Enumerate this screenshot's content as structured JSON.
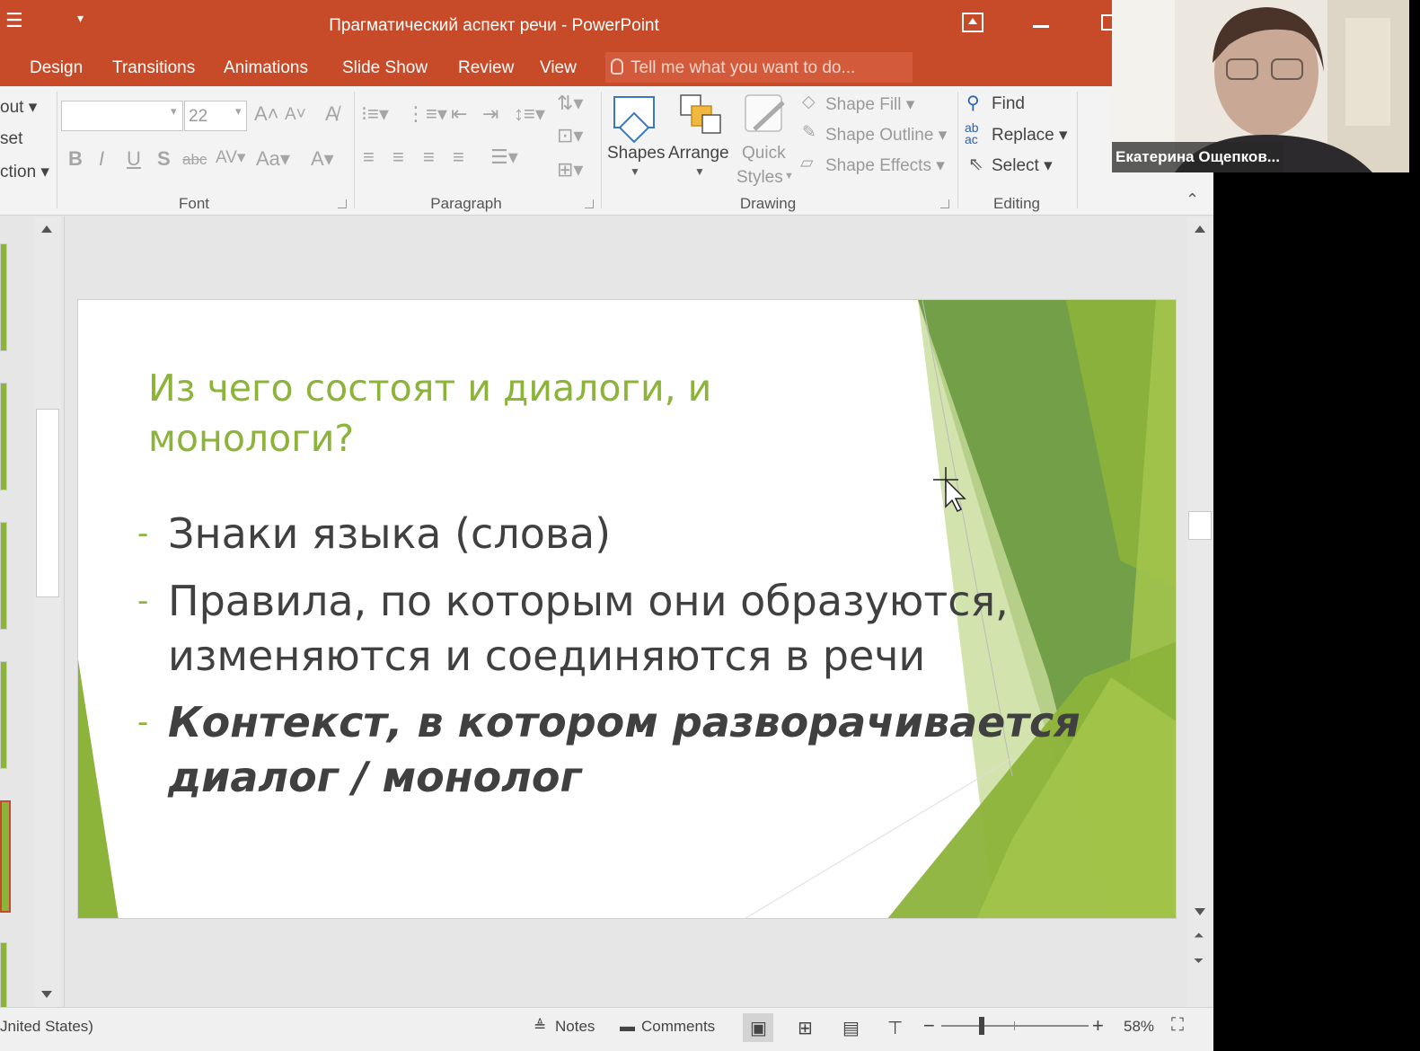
{
  "window": {
    "title": "Прагматический аспект речи - PowerPoint"
  },
  "tabs": [
    "Design",
    "Transitions",
    "Animations",
    "Slide Show",
    "Review",
    "View"
  ],
  "tellme": "Tell me what you want to do...",
  "ribbon": {
    "layout_partial": [
      "out",
      "set",
      "ction"
    ],
    "font_size": "22",
    "font_group": "Font",
    "paragraph_group": "Paragraph",
    "drawing_group": "Drawing",
    "editing_group": "Editing",
    "shapes": "Shapes",
    "arrange": "Arrange",
    "quick_styles_1": "Quick",
    "quick_styles_2": "Styles",
    "shape_fill": "Shape Fill",
    "shape_outline": "Shape Outline",
    "shape_effects": "Shape Effects",
    "find": "Find",
    "replace": "Replace",
    "select": "Select"
  },
  "slide": {
    "title_line1": "Из чего состоят и диалоги, и",
    "title_line2": "монологи?",
    "bullets": [
      {
        "line1": "Знаки языка (слова)",
        "line2": ""
      },
      {
        "line1": "Правила, по которым они образуются,",
        "line2": "изменяются и соединяются в речи"
      },
      {
        "line1": "Контекст, в котором разворачивается",
        "line2": "диалог / монолог"
      }
    ],
    "accent_color": "#8cb33a"
  },
  "status": {
    "language_partial": "Jnited States)",
    "notes": "Notes",
    "comments": "Comments",
    "zoom": "58%"
  },
  "webcam": {
    "participant_name": "Екатерина Ощепков..."
  },
  "colors": {
    "titlebar": "#c84b29",
    "green": "#8cb33a"
  }
}
